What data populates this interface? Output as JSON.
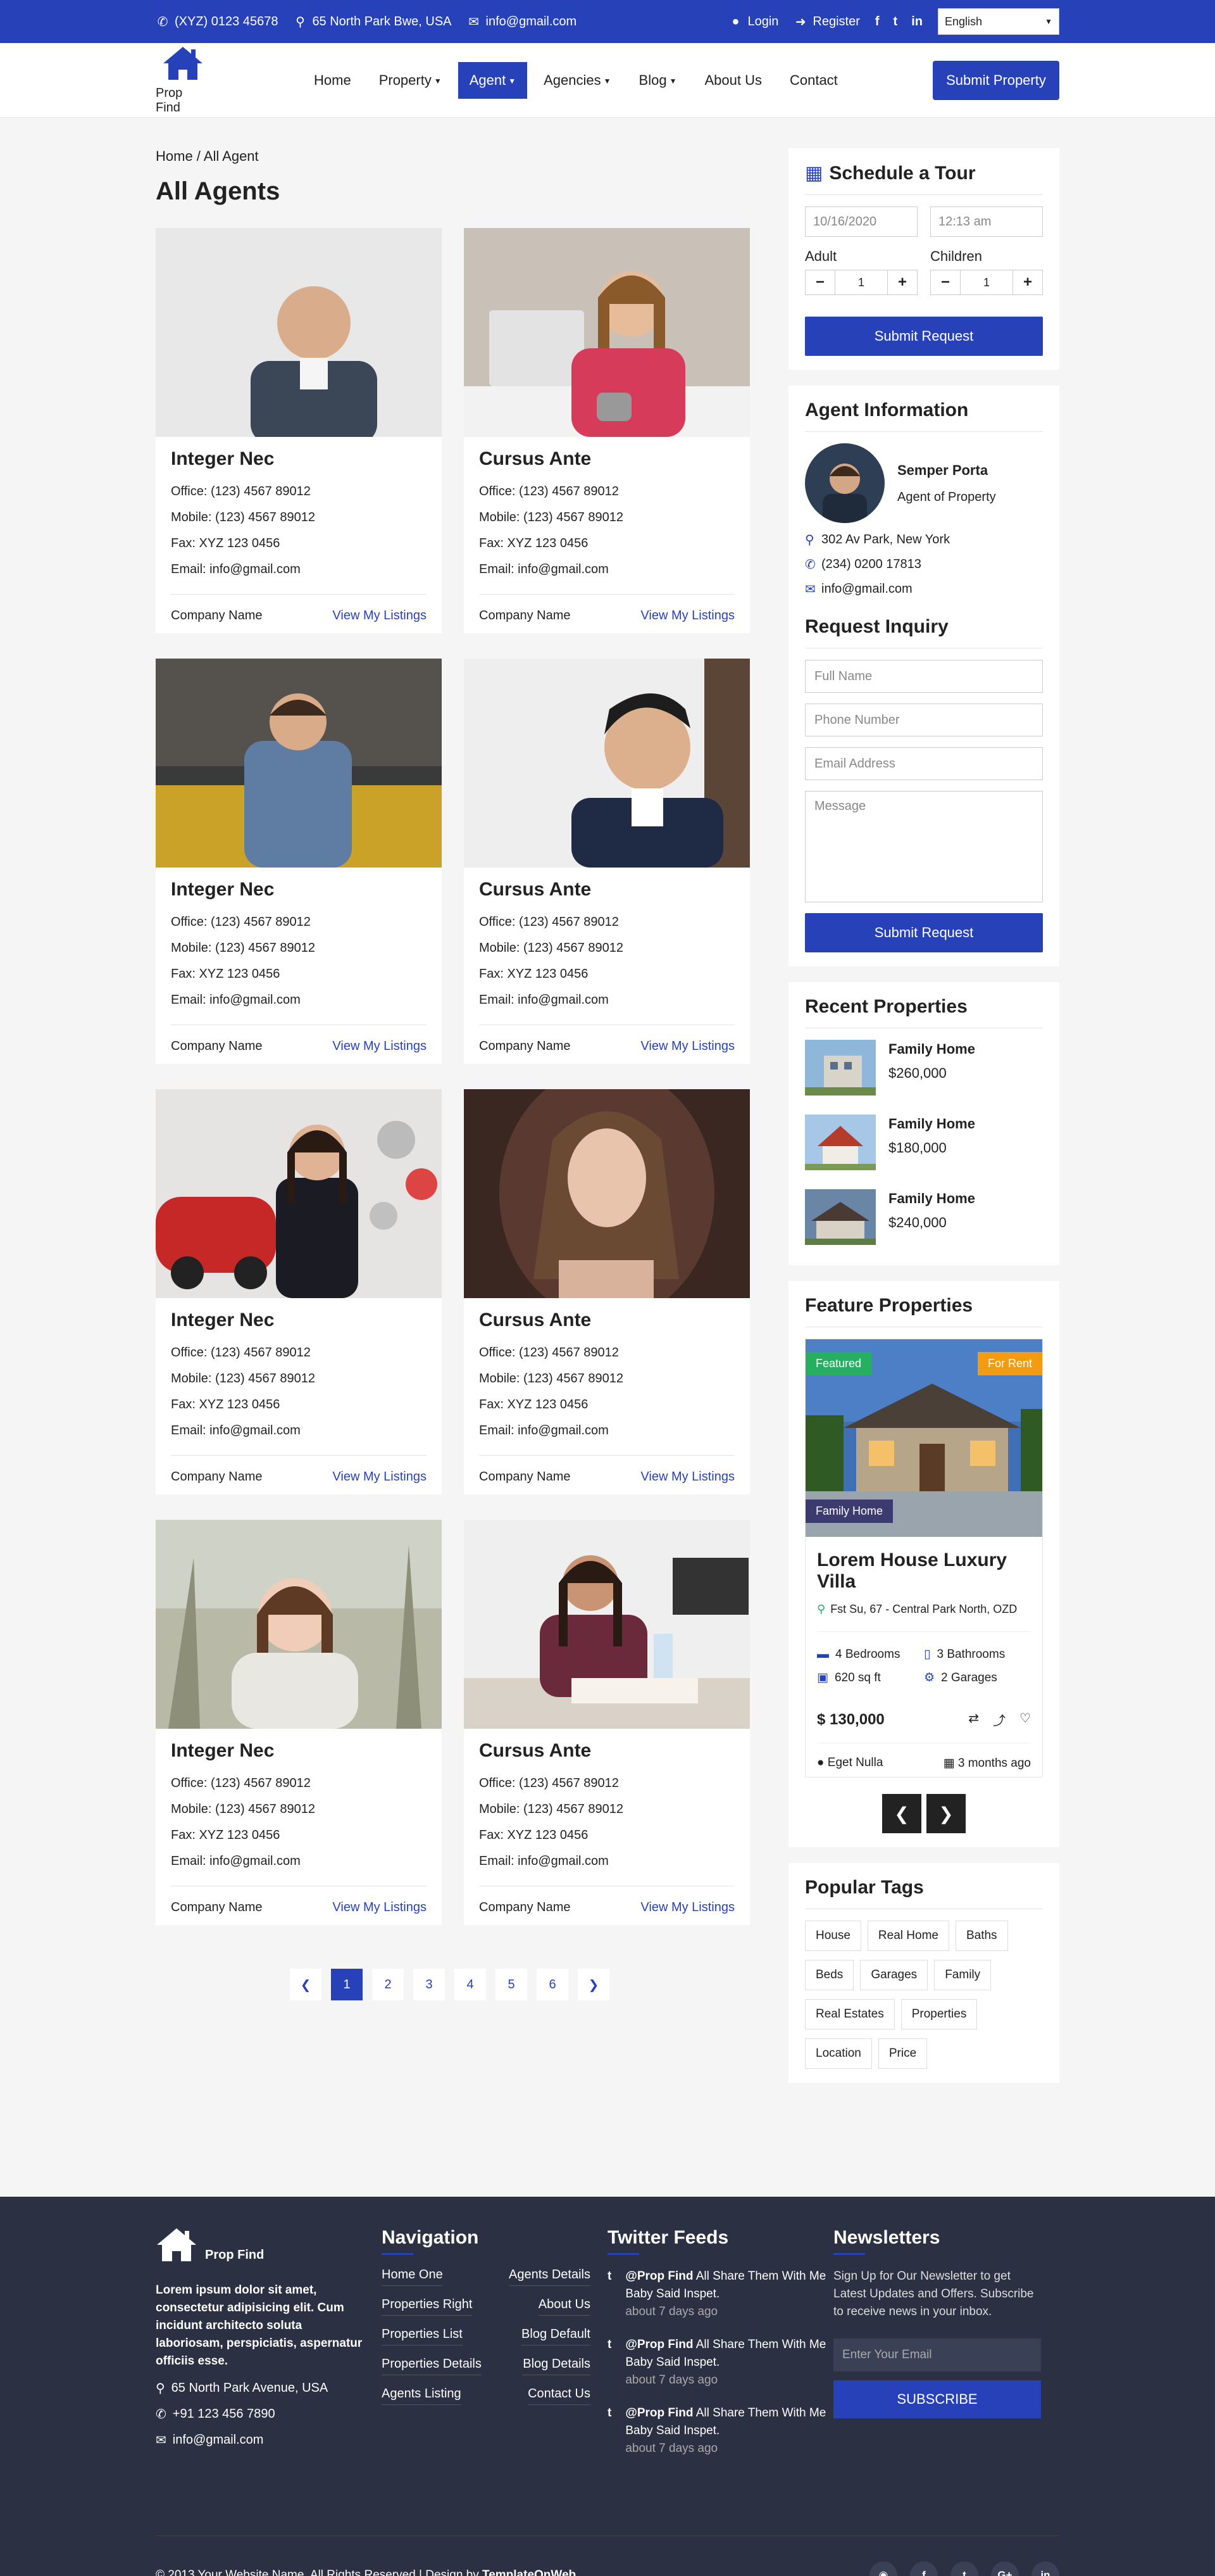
{
  "topbar": {
    "phone": "(XYZ) 0123 45678",
    "address": "65 North Park Bwe, USA",
    "email": "info@gmail.com",
    "login": "Login",
    "register": "Register",
    "language": "English"
  },
  "brand": {
    "name": "Prop Find"
  },
  "nav": {
    "items": [
      "Home",
      "Property",
      "Agent",
      "Agencies",
      "Blog",
      "About Us",
      "Contact"
    ],
    "active": "Agent",
    "submit_label": "Submit Property"
  },
  "page": {
    "breadcrumb": "Home / All Agent",
    "title": "All Agents"
  },
  "agents": [
    {
      "name": "Integer Nec",
      "office": "Office: (123) 4567 89012",
      "mobile": "Mobile: (123) 4567 89012",
      "fax": "Fax: XYZ 123 0456",
      "email": "Email: info@gmail.com",
      "company": "Company Name",
      "link": "View My Listings"
    },
    {
      "name": "Cursus Ante",
      "office": "Office: (123) 4567 89012",
      "mobile": "Mobile: (123) 4567 89012",
      "fax": "Fax: XYZ 123 0456",
      "email": "Email: info@gmail.com",
      "company": "Company Name",
      "link": "View My Listings"
    },
    {
      "name": "Integer Nec",
      "office": "Office: (123) 4567 89012",
      "mobile": "Mobile: (123) 4567 89012",
      "fax": "Fax: XYZ 123 0456",
      "email": "Email: info@gmail.com",
      "company": "Company Name",
      "link": "View My Listings"
    },
    {
      "name": "Cursus Ante",
      "office": "Office: (123) 4567 89012",
      "mobile": "Mobile: (123) 4567 89012",
      "fax": "Fax: XYZ 123 0456",
      "email": "Email: info@gmail.com",
      "company": "Company Name",
      "link": "View My Listings"
    },
    {
      "name": "Integer Nec",
      "office": "Office: (123) 4567 89012",
      "mobile": "Mobile: (123) 4567 89012",
      "fax": "Fax: XYZ 123 0456",
      "email": "Email: info@gmail.com",
      "company": "Company Name",
      "link": "View My Listings"
    },
    {
      "name": "Cursus Ante",
      "office": "Office: (123) 4567 89012",
      "mobile": "Mobile: (123) 4567 89012",
      "fax": "Fax: XYZ 123 0456",
      "email": "Email: info@gmail.com",
      "company": "Company Name",
      "link": "View My Listings"
    },
    {
      "name": "Integer Nec",
      "office": "Office: (123) 4567 89012",
      "mobile": "Mobile: (123) 4567 89012",
      "fax": "Fax: XYZ 123 0456",
      "email": "Email: info@gmail.com",
      "company": "Company Name",
      "link": "View My Listings"
    },
    {
      "name": "Cursus Ante",
      "office": "Office: (123) 4567 89012",
      "mobile": "Mobile: (123) 4567 89012",
      "fax": "Fax: XYZ 123 0456",
      "email": "Email: info@gmail.com",
      "company": "Company Name",
      "link": "View My Listings"
    }
  ],
  "pagination": {
    "pages": [
      "1",
      "2",
      "3",
      "4",
      "5",
      "6"
    ],
    "current": "1"
  },
  "tour": {
    "title": "Schedule a Tour",
    "date": "10/16/2020",
    "time": "12:13 am",
    "adult_label": "Adult",
    "children_label": "Children",
    "adult_value": "1",
    "children_value": "1",
    "submit": "Submit Request"
  },
  "agent_info": {
    "title": "Agent Information",
    "name": "Semper Porta",
    "role": "Agent of Property",
    "address": "302 Av Park, New York",
    "phone": "(234) 0200 17813",
    "email": "info@gmail.com"
  },
  "inquiry": {
    "title": "Request Inquiry",
    "name_ph": "Full Name",
    "phone_ph": "Phone Number",
    "email_ph": "Email Address",
    "message_ph": "Message",
    "submit": "Submit Request"
  },
  "recent": {
    "title": "Recent Properties",
    "items": [
      {
        "title": "Family Home",
        "price": "$260,000"
      },
      {
        "title": "Family Home",
        "price": "$180,000"
      },
      {
        "title": "Family Home",
        "price": "$240,000"
      }
    ]
  },
  "featured": {
    "title": "Feature Properties",
    "badge_featured": "Featured",
    "badge_rent": "For Rent",
    "type": "Family Home",
    "name": "Lorem House Luxury Villa",
    "location": "Fst Su, 67 - Central Park North, OZD",
    "bedrooms": "4 Bedrooms",
    "bathrooms": "3 Bathrooms",
    "area": "620 sq ft",
    "garages": "2 Garages",
    "price": "$ 130,000",
    "agent": "Eget Nulla",
    "time": "3 months ago"
  },
  "tags": {
    "title": "Popular Tags",
    "items": [
      "House",
      "Real Home",
      "Baths",
      "Beds",
      "Garages",
      "Family",
      "Real Estates",
      "Properties",
      "Location",
      "Price"
    ]
  },
  "footer": {
    "brand": "Prop Find",
    "desc": "Lorem ipsum dolor sit amet, consectetur adipisicing elit. Cum incidunt architecto soluta laboriosam, perspiciatis, aspernatur officiis esse.",
    "address": "65 North Park Avenue, USA",
    "phone": "+91 123 456 7890",
    "email": "info@gmail.com",
    "nav_title": "Navigation",
    "nav_links": [
      "Home One",
      "Agents Details",
      "Properties Right",
      "About Us",
      "Properties List",
      "Blog Default",
      "Properties Details",
      "Blog Details",
      "Agents Listing",
      "Contact Us"
    ],
    "twitter_title": "Twitter Feeds",
    "tweets": [
      {
        "handle": "@Prop Find",
        "text": " All Share Them With Me Baby Said Inspet.",
        "time": "about 7 days ago"
      },
      {
        "handle": "@Prop Find",
        "text": " All Share Them With Me Baby Said Inspet.",
        "time": "about 7 days ago"
      },
      {
        "handle": "@Prop Find",
        "text": " All Share Them With Me Baby Said Inspet.",
        "time": "about 7 days ago"
      }
    ],
    "newsletter_title": "Newsletters",
    "newsletter_text": "Sign Up for Our Newsletter to get Latest Updates and Offers. Subscribe to receive news in your inbox.",
    "newsletter_ph": "Enter Your Email",
    "subscribe": "SUBSCRIBE",
    "copyright": "© 2013 Your Website Name. All Rights Reserved | Design by ",
    "designer": "TemplateOnWeb"
  },
  "colors": {
    "primary": "#2741b8",
    "footer_bg": "#2b3043",
    "page_bg": "#f5f5f5",
    "featured_green": "#27ae60",
    "rent_orange": "#f39c12"
  }
}
